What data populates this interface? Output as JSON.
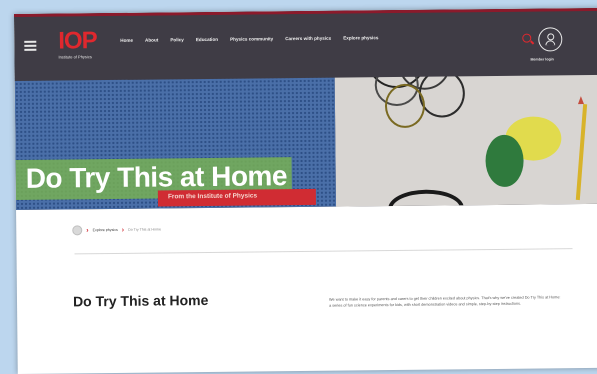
{
  "header": {
    "logo_mark": "IOP",
    "logo_sub": "Institute of Physics",
    "nav": [
      "Home",
      "About",
      "Policy",
      "Education",
      "Physics community",
      "Careers with physics",
      "Explore physics"
    ],
    "account_label": "Member login"
  },
  "hero": {
    "title": "Do Try This at Home",
    "subtitle": "From the Institute of Physics"
  },
  "breadcrumb": {
    "items": [
      "Explore physics",
      "Do Try This at Home"
    ]
  },
  "main": {
    "title": "Do Try This at Home",
    "intro": "We want to make it easy for parents and carers to get their children excited about physics. That's why we've created Do Try This at Home: a series of fun science experiments for kids, with short demonstration videos and simple, step-by-step instructions."
  },
  "icons": [
    "menu-icon",
    "search-icon",
    "account-icon",
    "home-icon",
    "chevron-right-icon"
  ],
  "colors": {
    "brand_red": "#e0282e",
    "topbar": "#3f3c45",
    "hero_green": "#79b252",
    "hero_subtitle_red": "#d02c33"
  }
}
